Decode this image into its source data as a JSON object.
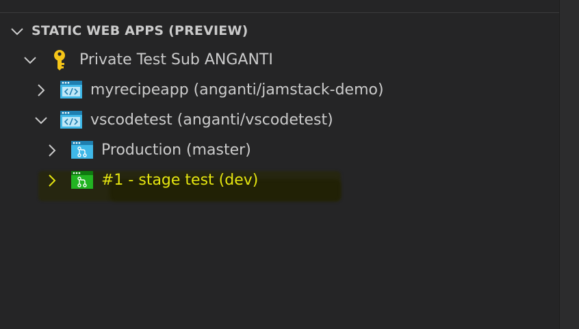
{
  "section": {
    "title": "STATIC WEB APPS (PREVIEW)"
  },
  "tree": {
    "subscription": {
      "label": "Private Test Sub ANGANTI",
      "icon": "key-icon"
    },
    "apps": [
      {
        "label": "myrecipeapp (anganti/jamstack-demo)",
        "icon": "web-app-icon",
        "expanded": false
      },
      {
        "label": "vscodetest (anganti/vscodetest)",
        "icon": "web-app-icon",
        "expanded": true
      }
    ],
    "environments": [
      {
        "label": "Production (master)",
        "icon": "environment-branch-icon",
        "color": "#3fb8e8"
      },
      {
        "label": "#1 - stage test (dev)",
        "icon": "environment-branch-icon",
        "color": "#22b422"
      }
    ]
  },
  "colors": {
    "background": "#252526",
    "text": "#cccccc",
    "highlight_text": "#e5e510",
    "key": "#f5c518",
    "app_icon": "#3fb8e8",
    "stage_icon": "#22b422"
  }
}
